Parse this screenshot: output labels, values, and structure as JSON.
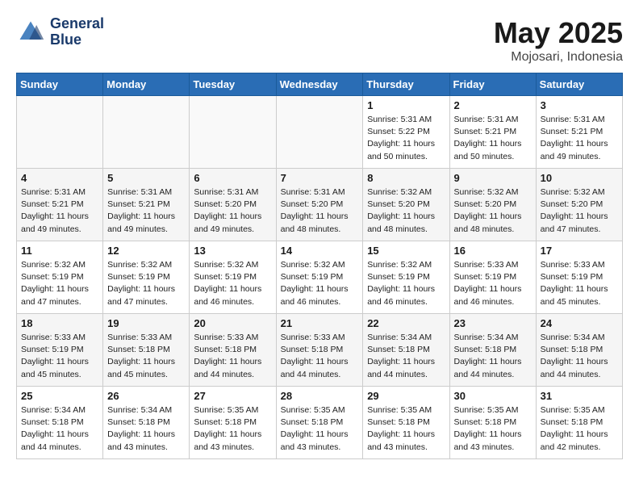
{
  "header": {
    "logo_line1": "General",
    "logo_line2": "Blue",
    "month": "May 2025",
    "location": "Mojosari, Indonesia"
  },
  "days_of_week": [
    "Sunday",
    "Monday",
    "Tuesday",
    "Wednesday",
    "Thursday",
    "Friday",
    "Saturday"
  ],
  "weeks": [
    [
      {
        "num": "",
        "detail": ""
      },
      {
        "num": "",
        "detail": ""
      },
      {
        "num": "",
        "detail": ""
      },
      {
        "num": "",
        "detail": ""
      },
      {
        "num": "1",
        "detail": "Sunrise: 5:31 AM\nSunset: 5:22 PM\nDaylight: 11 hours\nand 50 minutes."
      },
      {
        "num": "2",
        "detail": "Sunrise: 5:31 AM\nSunset: 5:21 PM\nDaylight: 11 hours\nand 50 minutes."
      },
      {
        "num": "3",
        "detail": "Sunrise: 5:31 AM\nSunset: 5:21 PM\nDaylight: 11 hours\nand 49 minutes."
      }
    ],
    [
      {
        "num": "4",
        "detail": "Sunrise: 5:31 AM\nSunset: 5:21 PM\nDaylight: 11 hours\nand 49 minutes."
      },
      {
        "num": "5",
        "detail": "Sunrise: 5:31 AM\nSunset: 5:21 PM\nDaylight: 11 hours\nand 49 minutes."
      },
      {
        "num": "6",
        "detail": "Sunrise: 5:31 AM\nSunset: 5:20 PM\nDaylight: 11 hours\nand 49 minutes."
      },
      {
        "num": "7",
        "detail": "Sunrise: 5:31 AM\nSunset: 5:20 PM\nDaylight: 11 hours\nand 48 minutes."
      },
      {
        "num": "8",
        "detail": "Sunrise: 5:32 AM\nSunset: 5:20 PM\nDaylight: 11 hours\nand 48 minutes."
      },
      {
        "num": "9",
        "detail": "Sunrise: 5:32 AM\nSunset: 5:20 PM\nDaylight: 11 hours\nand 48 minutes."
      },
      {
        "num": "10",
        "detail": "Sunrise: 5:32 AM\nSunset: 5:20 PM\nDaylight: 11 hours\nand 47 minutes."
      }
    ],
    [
      {
        "num": "11",
        "detail": "Sunrise: 5:32 AM\nSunset: 5:19 PM\nDaylight: 11 hours\nand 47 minutes."
      },
      {
        "num": "12",
        "detail": "Sunrise: 5:32 AM\nSunset: 5:19 PM\nDaylight: 11 hours\nand 47 minutes."
      },
      {
        "num": "13",
        "detail": "Sunrise: 5:32 AM\nSunset: 5:19 PM\nDaylight: 11 hours\nand 46 minutes."
      },
      {
        "num": "14",
        "detail": "Sunrise: 5:32 AM\nSunset: 5:19 PM\nDaylight: 11 hours\nand 46 minutes."
      },
      {
        "num": "15",
        "detail": "Sunrise: 5:32 AM\nSunset: 5:19 PM\nDaylight: 11 hours\nand 46 minutes."
      },
      {
        "num": "16",
        "detail": "Sunrise: 5:33 AM\nSunset: 5:19 PM\nDaylight: 11 hours\nand 46 minutes."
      },
      {
        "num": "17",
        "detail": "Sunrise: 5:33 AM\nSunset: 5:19 PM\nDaylight: 11 hours\nand 45 minutes."
      }
    ],
    [
      {
        "num": "18",
        "detail": "Sunrise: 5:33 AM\nSunset: 5:19 PM\nDaylight: 11 hours\nand 45 minutes."
      },
      {
        "num": "19",
        "detail": "Sunrise: 5:33 AM\nSunset: 5:18 PM\nDaylight: 11 hours\nand 45 minutes."
      },
      {
        "num": "20",
        "detail": "Sunrise: 5:33 AM\nSunset: 5:18 PM\nDaylight: 11 hours\nand 44 minutes."
      },
      {
        "num": "21",
        "detail": "Sunrise: 5:33 AM\nSunset: 5:18 PM\nDaylight: 11 hours\nand 44 minutes."
      },
      {
        "num": "22",
        "detail": "Sunrise: 5:34 AM\nSunset: 5:18 PM\nDaylight: 11 hours\nand 44 minutes."
      },
      {
        "num": "23",
        "detail": "Sunrise: 5:34 AM\nSunset: 5:18 PM\nDaylight: 11 hours\nand 44 minutes."
      },
      {
        "num": "24",
        "detail": "Sunrise: 5:34 AM\nSunset: 5:18 PM\nDaylight: 11 hours\nand 44 minutes."
      }
    ],
    [
      {
        "num": "25",
        "detail": "Sunrise: 5:34 AM\nSunset: 5:18 PM\nDaylight: 11 hours\nand 44 minutes."
      },
      {
        "num": "26",
        "detail": "Sunrise: 5:34 AM\nSunset: 5:18 PM\nDaylight: 11 hours\nand 43 minutes."
      },
      {
        "num": "27",
        "detail": "Sunrise: 5:35 AM\nSunset: 5:18 PM\nDaylight: 11 hours\nand 43 minutes."
      },
      {
        "num": "28",
        "detail": "Sunrise: 5:35 AM\nSunset: 5:18 PM\nDaylight: 11 hours\nand 43 minutes."
      },
      {
        "num": "29",
        "detail": "Sunrise: 5:35 AM\nSunset: 5:18 PM\nDaylight: 11 hours\nand 43 minutes."
      },
      {
        "num": "30",
        "detail": "Sunrise: 5:35 AM\nSunset: 5:18 PM\nDaylight: 11 hours\nand 43 minutes."
      },
      {
        "num": "31",
        "detail": "Sunrise: 5:35 AM\nSunset: 5:18 PM\nDaylight: 11 hours\nand 42 minutes."
      }
    ]
  ]
}
